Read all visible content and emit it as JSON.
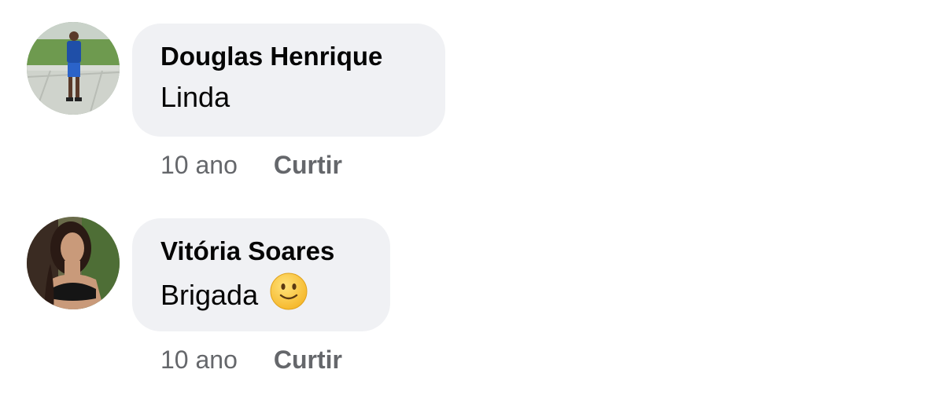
{
  "comments": [
    {
      "author": "Douglas Henrique",
      "text": "Linda",
      "time": "10 ano",
      "like_label": "Curtir",
      "avatar_icon": "profile-photo-boy-soccer-field"
    },
    {
      "author": "Vitória Soares",
      "text": "Brigada",
      "emoji": "slightly-smiling-face",
      "time": "10 ano",
      "like_label": "Curtir",
      "avatar_icon": "profile-photo-girl-portrait"
    }
  ],
  "colors": {
    "bubble_bg": "#f0f1f4",
    "text": "#050505",
    "meta": "#65676b",
    "background": "#ffffff"
  }
}
